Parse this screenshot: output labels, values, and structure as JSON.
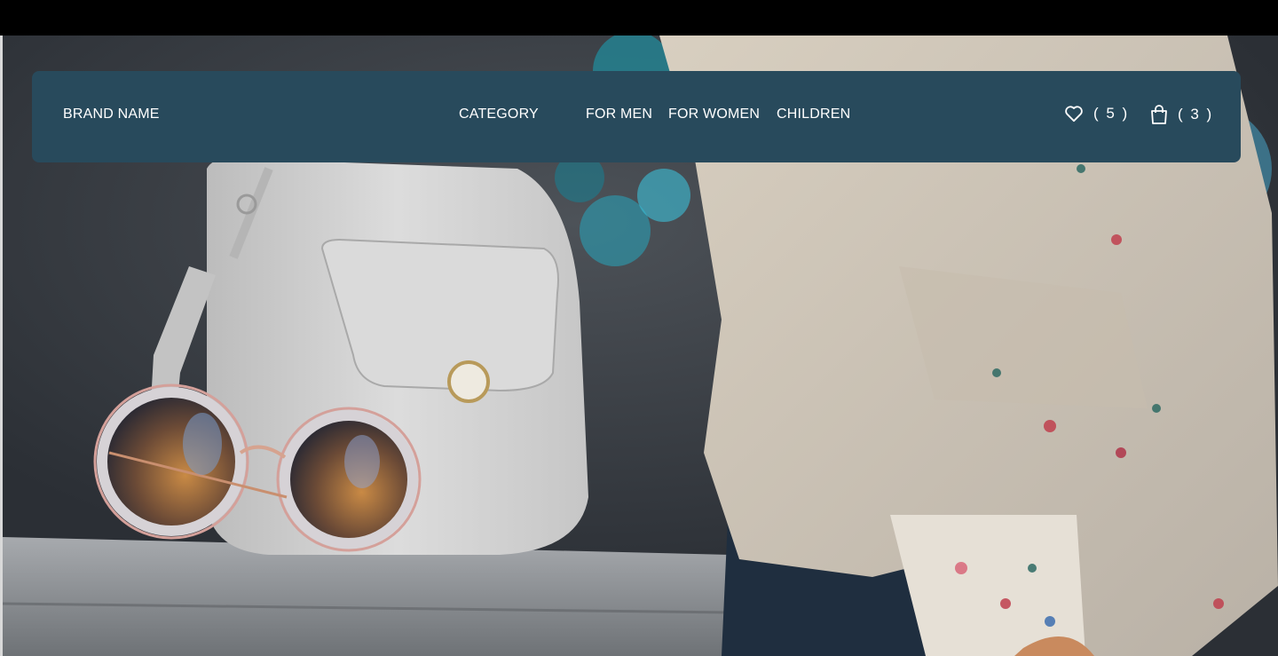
{
  "nav": {
    "brand": "BRAND NAME",
    "links": [
      {
        "label": "CATEGORY"
      },
      {
        "label": "FOR MEN"
      },
      {
        "label": "FOR WOMEN"
      },
      {
        "label": "CHILDREN"
      }
    ],
    "wishlist": {
      "count_text": "( 5 )",
      "icon": "heart-icon"
    },
    "cart": {
      "count_text": "( 3 )",
      "icon": "shopping-bag-icon"
    }
  },
  "colors": {
    "navbar_bg": "#284a5c",
    "nav_text": "#ffffff",
    "page_top_bar": "#000000"
  }
}
